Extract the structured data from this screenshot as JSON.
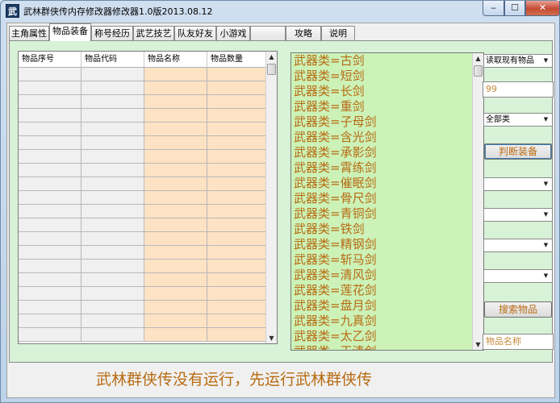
{
  "window": {
    "title": "武林群侠传内存修改器修改器1.0版2013.08.12",
    "app_icon_char": "武",
    "icon": "wuxia-app-icon"
  },
  "tabs": [
    {
      "label": "主角属性"
    },
    {
      "label": "物品装备"
    },
    {
      "label": "称号经历"
    },
    {
      "label": "武艺技艺"
    },
    {
      "label": "队友好友"
    },
    {
      "label": "小游戏"
    },
    {
      "label": ""
    },
    {
      "label": "攻略"
    },
    {
      "label": "说明"
    }
  ],
  "active_tab": "物品装备",
  "grid": {
    "columns": [
      "物品序号",
      "物品代码",
      "物品名称",
      "物品数量"
    ],
    "row_count": 20
  },
  "items": [
    "武器类=古剑",
    "武器类=短剑",
    "武器类=长剑",
    "武器类=重剑",
    "武器类=子母剑",
    "武器类=含光剑",
    "武器类=承影剑",
    "武器类=霄练剑",
    "武器类=催眠剑",
    "武器类=骨尺剑",
    "武器类=青铜剑",
    "武器类=铁剑",
    "武器类=精钢剑",
    "武器类=斩马剑",
    "武器类=清风剑",
    "武器类=莲花剑",
    "武器类=盘月剑",
    "武器类=九真剑",
    "武器类=太乙剑",
    "武器类=玉清剑"
  ],
  "controls": {
    "read_select": "读取现有物品",
    "count_input": "99",
    "category_select": "全部类",
    "judge_button": "判断装备",
    "search_button": "搜索物品",
    "name_input": "物品名称"
  },
  "status_text": "武林群侠传没有运行，先运行武林群侠传",
  "colors": {
    "panel_bg": "#d8f2d8",
    "list_bg": "#ccf2b8",
    "accent_text": "#b86b12",
    "orange_cell": "#fde3c4"
  }
}
